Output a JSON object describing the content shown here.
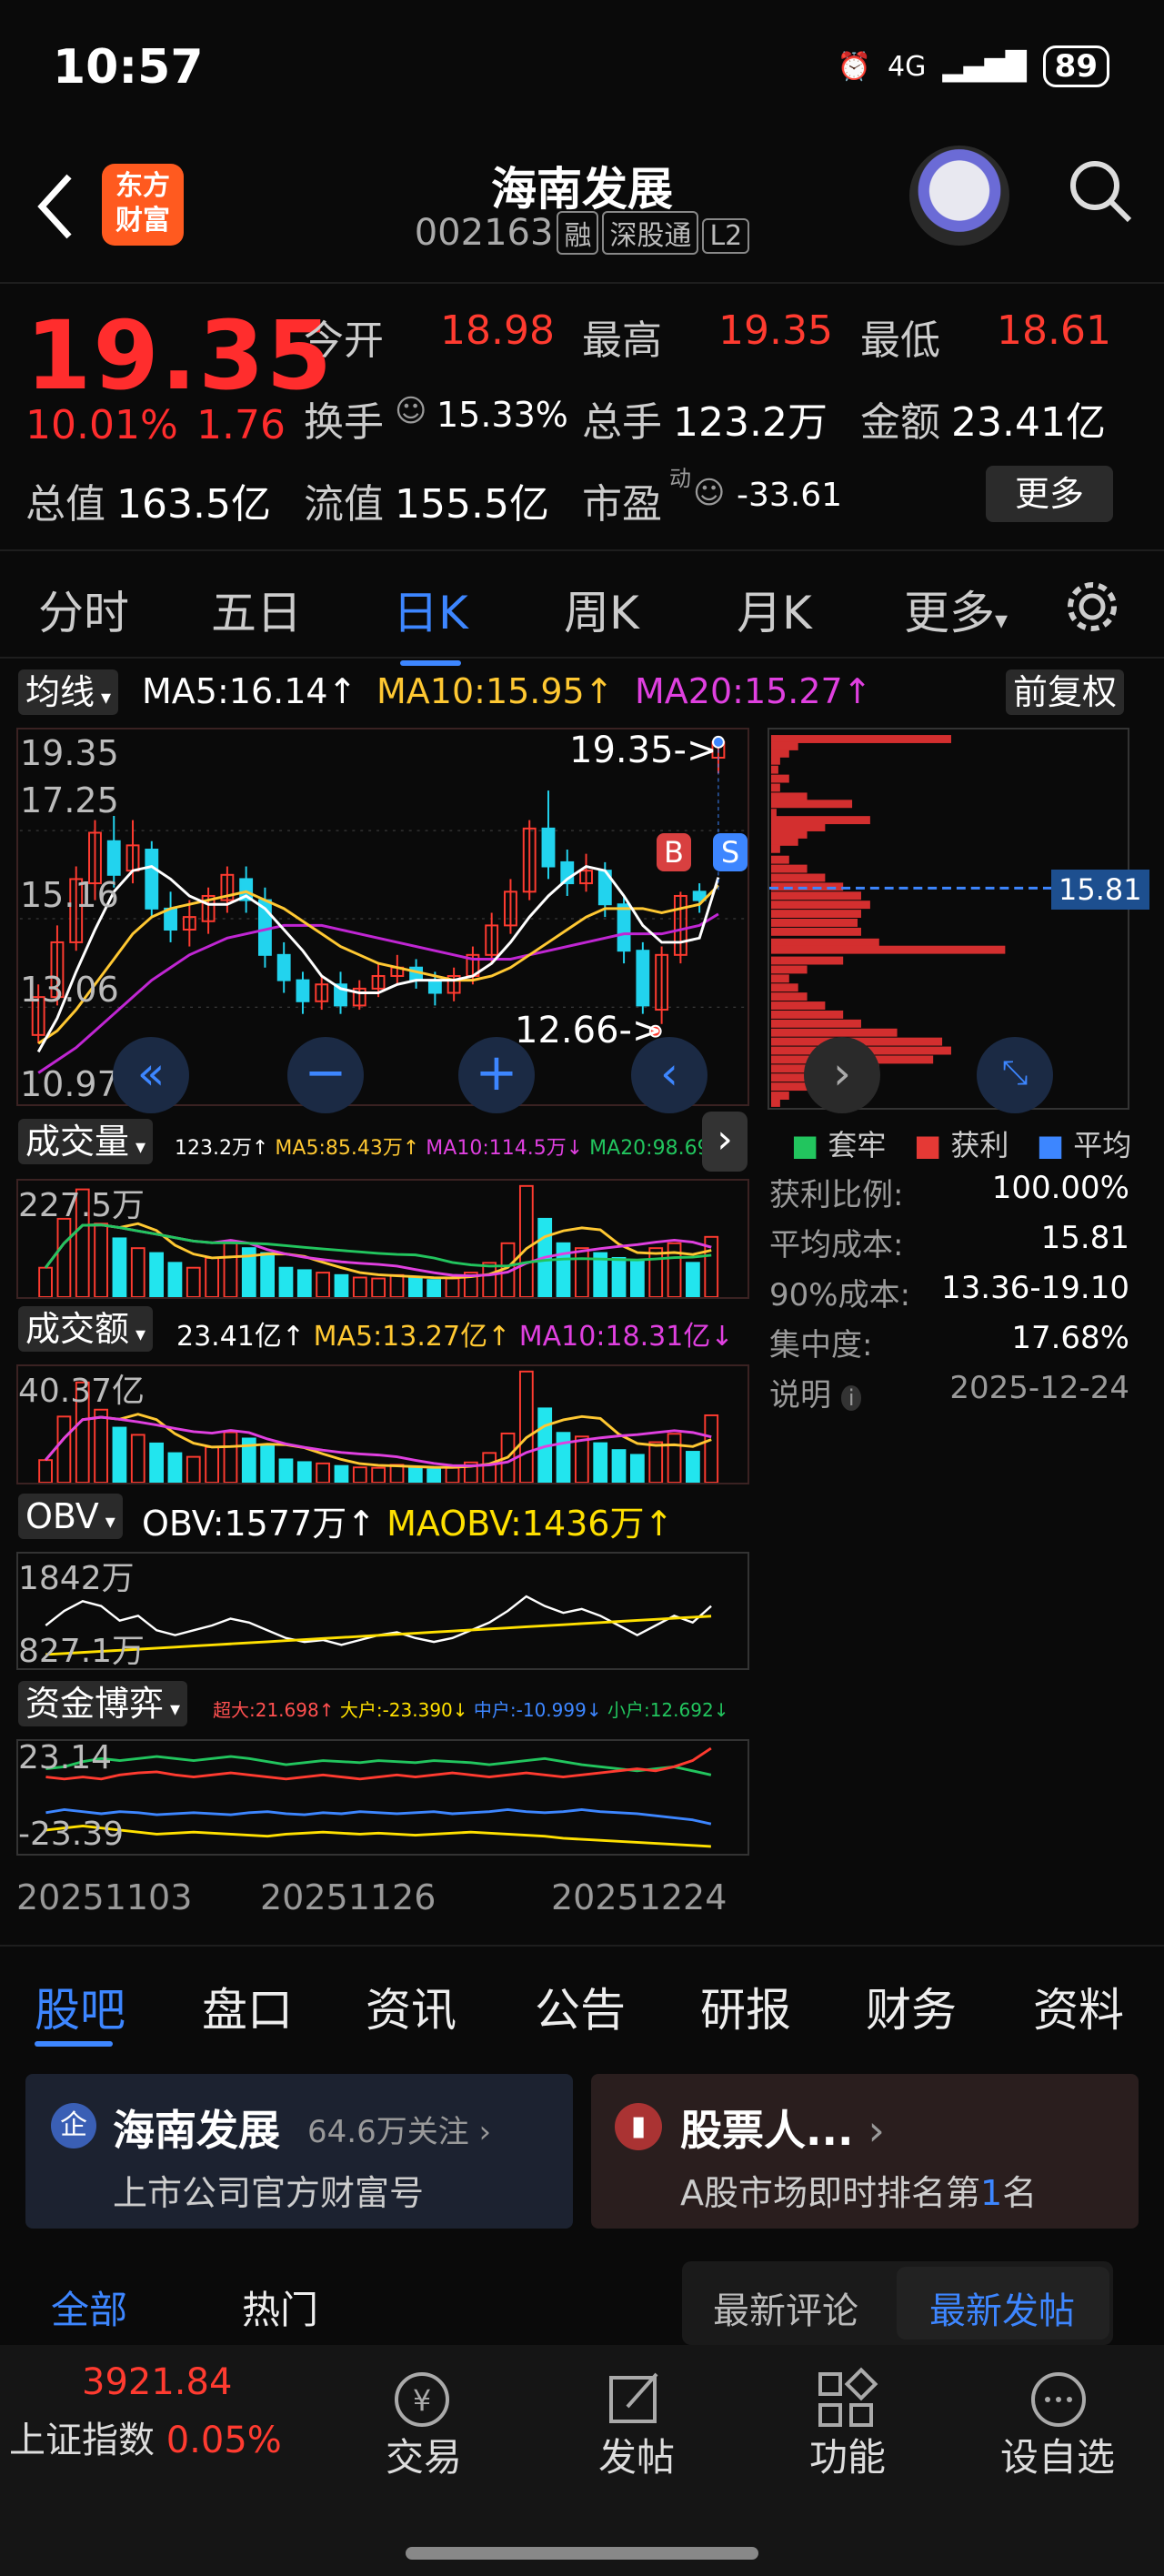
{
  "status": {
    "time": "10:57",
    "network": "4G",
    "battery": "89"
  },
  "header": {
    "title": "海南发展",
    "code": "002163",
    "tags": [
      "融",
      "深股通",
      "L2"
    ],
    "logo_lines": [
      "东方",
      "财富"
    ]
  },
  "quote": {
    "price": "19.35",
    "pct": "10.01%",
    "change": "1.76",
    "open_lbl": "今开",
    "open": "18.98",
    "high_lbl": "最高",
    "high": "19.35",
    "low_lbl": "最低",
    "low": "18.61",
    "turnover_lbl": "换手",
    "turnover": "15.33%",
    "vol_lbl": "总手",
    "vol": "123.2万",
    "amt_lbl": "金额",
    "amt": "23.41亿",
    "mcap_lbl": "总值",
    "mcap": "163.5亿",
    "float_lbl": "流值",
    "float": "155.5亿",
    "pe_lbl": "市盈",
    "pe_sup": "动",
    "pe": "-33.61",
    "more": "更多"
  },
  "ktabs": [
    "分时",
    "五日",
    "日K",
    "周K",
    "月K",
    "更多"
  ],
  "ma_bar": {
    "label": "均线",
    "ma5": "MA5:16.14",
    "ma10": "MA10:15.95",
    "ma20": "MA20:15.27",
    "adjust": "前复权"
  },
  "main_chart": {
    "ytop": "19.35",
    "y2": "17.25",
    "y3": "15.16",
    "y4": "13.06",
    "ybot": "10.97",
    "hi_note": "19.35->",
    "lo_note": "12.66->",
    "b": "B",
    "s": "S"
  },
  "chip": {
    "avg": "15.81",
    "legend": [
      "套牢",
      "获利",
      "平均"
    ],
    "rows": [
      {
        "k": "获利比例:",
        "v": "100.00%"
      },
      {
        "k": "平均成本:",
        "v": "15.81"
      },
      {
        "k": "90%成本:",
        "v": "13.36-19.10"
      },
      {
        "k": "集中度:",
        "v": "17.68%"
      },
      {
        "k": "说明",
        "v": "2025-12-24"
      }
    ]
  },
  "vol_bar": {
    "label": "成交量",
    "v": "123.2万",
    "ma5": "MA5:85.43万",
    "ma10": "MA10:114.5万",
    "ma20": "MA20:98.69万",
    "ytop": "227.5万"
  },
  "amt_bar": {
    "label": "成交额",
    "v": "23.41亿",
    "ma5": "MA5:13.27亿",
    "ma10": "MA10:18.31亿",
    "ytop": "40.37亿"
  },
  "obv_bar": {
    "label": "OBV",
    "obv": "OBV:1577万",
    "maobv": "MAOBV:1436万",
    "ytop": "1842万",
    "ybot": "827.1万"
  },
  "fund_bar": {
    "label": "资金博弈",
    "super": "超大:21.698",
    "big": "大户:-23.390",
    "mid": "中户:-10.999",
    "small": "小户:12.692",
    "ytop": "23.14",
    "ybot": "-23.39"
  },
  "dates": [
    "20251103",
    "20251126",
    "20251224"
  ],
  "chart_data": {
    "type": "candlestick",
    "series": [
      {
        "o": 12.4,
        "c": 13.3,
        "h": 13.6,
        "l": 12.2
      },
      {
        "o": 13.3,
        "c": 14.6,
        "h": 15.0,
        "l": 13.1
      },
      {
        "o": 14.6,
        "c": 16.1,
        "h": 16.4,
        "l": 14.4
      },
      {
        "o": 16.0,
        "c": 17.2,
        "h": 17.5,
        "l": 15.6
      },
      {
        "o": 17.0,
        "c": 16.2,
        "h": 17.6,
        "l": 15.9
      },
      {
        "o": 16.3,
        "c": 16.9,
        "h": 17.5,
        "l": 16.0
      },
      {
        "o": 16.8,
        "c": 15.4,
        "h": 17.0,
        "l": 15.2
      },
      {
        "o": 15.4,
        "c": 14.9,
        "h": 15.8,
        "l": 14.6
      },
      {
        "o": 14.9,
        "c": 15.2,
        "h": 15.6,
        "l": 14.5
      },
      {
        "o": 15.1,
        "c": 15.7,
        "h": 15.9,
        "l": 14.8
      },
      {
        "o": 15.6,
        "c": 16.2,
        "h": 16.4,
        "l": 15.3
      },
      {
        "o": 16.1,
        "c": 15.6,
        "h": 16.4,
        "l": 15.3
      },
      {
        "o": 15.6,
        "c": 14.3,
        "h": 15.9,
        "l": 14.0
      },
      {
        "o": 14.3,
        "c": 13.7,
        "h": 14.6,
        "l": 13.4
      },
      {
        "o": 13.7,
        "c": 13.2,
        "h": 13.9,
        "l": 12.9
      },
      {
        "o": 13.2,
        "c": 13.6,
        "h": 13.8,
        "l": 13.0
      },
      {
        "o": 13.6,
        "c": 13.1,
        "h": 13.9,
        "l": 12.9
      },
      {
        "o": 13.1,
        "c": 13.5,
        "h": 13.7,
        "l": 13.0
      },
      {
        "o": 13.5,
        "c": 13.8,
        "h": 14.1,
        "l": 13.3
      },
      {
        "o": 13.8,
        "c": 14.0,
        "h": 14.3,
        "l": 13.6
      },
      {
        "o": 14.0,
        "c": 13.7,
        "h": 14.2,
        "l": 13.5
      },
      {
        "o": 13.7,
        "c": 13.4,
        "h": 13.9,
        "l": 13.1
      },
      {
        "o": 13.4,
        "c": 13.8,
        "h": 14.0,
        "l": 13.2
      },
      {
        "o": 13.8,
        "c": 14.3,
        "h": 14.5,
        "l": 13.6
      },
      {
        "o": 14.3,
        "c": 15.0,
        "h": 15.3,
        "l": 14.1
      },
      {
        "o": 15.0,
        "c": 15.8,
        "h": 16.1,
        "l": 14.8
      },
      {
        "o": 15.8,
        "c": 17.3,
        "h": 17.5,
        "l": 15.6
      },
      {
        "o": 17.3,
        "c": 16.4,
        "h": 18.2,
        "l": 16.1
      },
      {
        "o": 16.5,
        "c": 16.0,
        "h": 16.8,
        "l": 15.7
      },
      {
        "o": 16.0,
        "c": 16.3,
        "h": 16.7,
        "l": 15.8
      },
      {
        "o": 16.3,
        "c": 15.5,
        "h": 16.5,
        "l": 15.2
      },
      {
        "o": 15.5,
        "c": 14.4,
        "h": 15.7,
        "l": 14.1
      },
      {
        "o": 14.4,
        "c": 13.1,
        "h": 14.6,
        "l": 12.9
      },
      {
        "o": 13.0,
        "c": 14.3,
        "h": 14.5,
        "l": 12.66
      },
      {
        "o": 14.3,
        "c": 15.7,
        "h": 15.8,
        "l": 14.1
      },
      {
        "o": 15.8,
        "c": 15.6,
        "h": 16.0,
        "l": 15.3
      },
      {
        "o": 18.98,
        "c": 19.35,
        "h": 19.35,
        "l": 18.61
      }
    ],
    "ma5": [
      12.0,
      12.8,
      13.9,
      14.9,
      15.8,
      16.3,
      16.4,
      16.1,
      15.7,
      15.5,
      15.5,
      15.7,
      15.4,
      14.9,
      14.4,
      13.8,
      13.5,
      13.4,
      13.4,
      13.6,
      13.7,
      13.7,
      13.7,
      13.8,
      14.1,
      14.6,
      15.2,
      15.7,
      16.1,
      16.4,
      16.3,
      15.7,
      15.0,
      14.6,
      14.6,
      14.7,
      16.14
    ],
    "ma10": [
      12.2,
      12.5,
      13.0,
      13.6,
      14.2,
      14.8,
      15.2,
      15.4,
      15.5,
      15.6,
      15.7,
      15.8,
      15.6,
      15.4,
      15.1,
      14.8,
      14.5,
      14.3,
      14.1,
      14.0,
      13.9,
      13.8,
      13.7,
      13.7,
      13.8,
      14.0,
      14.3,
      14.6,
      14.9,
      15.2,
      15.4,
      15.4,
      15.4,
      15.3,
      15.4,
      15.5,
      15.95
    ],
    "ma20": [
      11.5,
      11.8,
      12.1,
      12.5,
      12.9,
      13.3,
      13.7,
      14.0,
      14.3,
      14.5,
      14.7,
      14.8,
      14.9,
      15.0,
      15.0,
      15.0,
      14.9,
      14.8,
      14.7,
      14.6,
      14.5,
      14.4,
      14.3,
      14.2,
      14.2,
      14.2,
      14.3,
      14.4,
      14.5,
      14.6,
      14.7,
      14.8,
      14.8,
      14.8,
      14.9,
      15.0,
      15.27
    ]
  }
}
